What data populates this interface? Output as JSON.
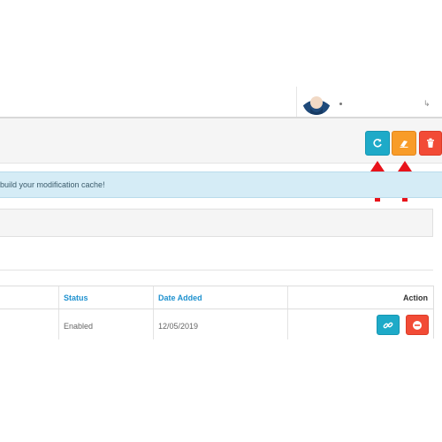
{
  "alert": {
    "message": "build your modification cache!"
  },
  "toolbar": {
    "refresh_icon": "refresh-icon",
    "clear_icon": "eraser-icon",
    "delete_icon": "trash-icon"
  },
  "annotation": {
    "arrow_color": "#e8121a"
  },
  "table": {
    "headers": {
      "status": "Status",
      "date_added": "Date Added",
      "action": "Action"
    },
    "rows": [
      {
        "status": "Enabled",
        "date_added": "12/05/2019",
        "actions": [
          "link-icon",
          "minus-circle-icon"
        ]
      }
    ]
  },
  "colors": {
    "info_blue": "#1eaac8",
    "warning_orange": "#f89c29",
    "danger_red": "#f24b36",
    "link_blue": "#1e91cf",
    "alert_bg": "#d5ecf6"
  }
}
